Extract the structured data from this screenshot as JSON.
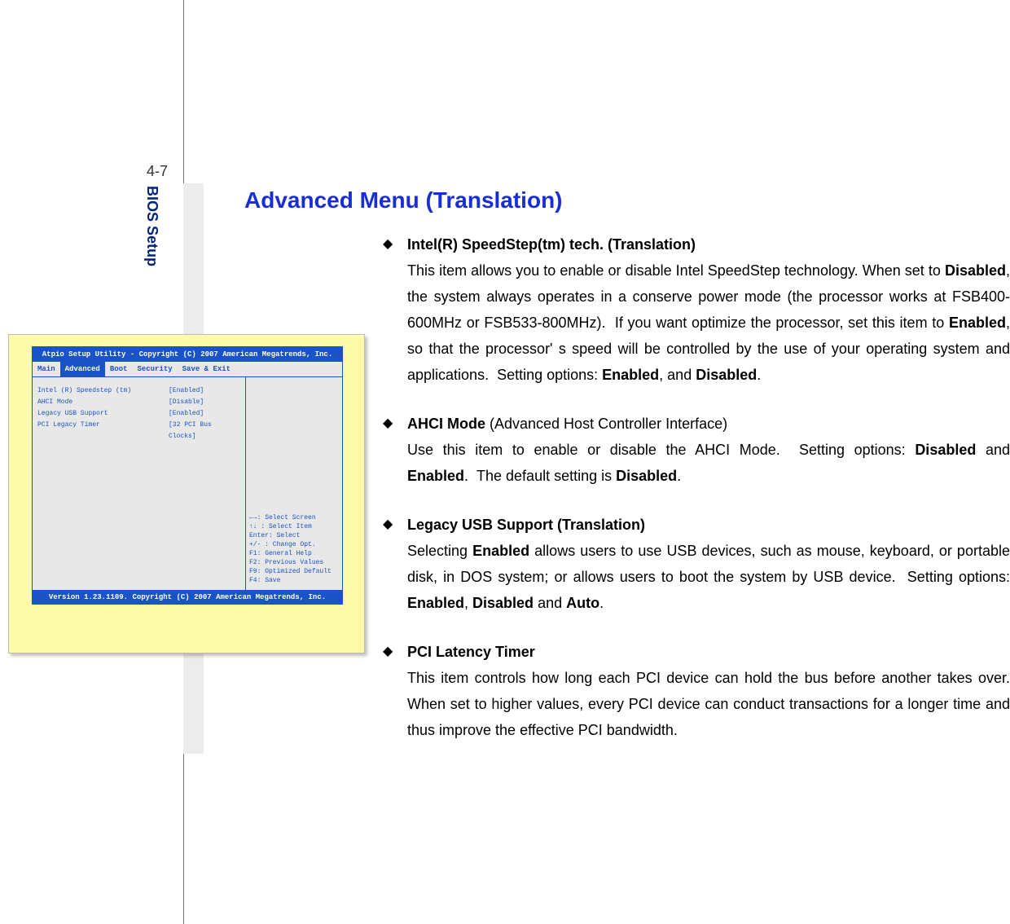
{
  "page": {
    "number": "4-7",
    "side_label": "BIOS Setup",
    "heading": "Advanced Menu (Translation)"
  },
  "sections": [
    {
      "title": "Intel(R) SpeedStep(tm) tech. (Translation)",
      "title_trailing": "",
      "body_html": "This item allows you to enable or disable Intel SpeedStep technology. When set to <b>Disabled</b>, the system always operates in a conserve power mode (the processor works at FSB400-600MHz or FSB533-800MHz).&nbsp;&nbsp;If you want optimize the processor, set this item to <b>Enabled</b>, so that the processor' s speed will be controlled by the use of your operating system and applications.&nbsp;&nbsp;Setting options: <b>Enabled</b>, and <b>Disabled</b>."
    },
    {
      "title": "AHCI Mode",
      "title_trailing": " (Advanced Host Controller Interface)",
      "body_html": "Use this item to enable or disable the AHCI Mode.&nbsp;&nbsp;Setting options: <b>Disabled</b> and <b>Enabled</b>.&nbsp;&nbsp;The default setting is <b>Disabled</b>."
    },
    {
      "title": "Legacy USB Support (Translation)",
      "title_trailing": "",
      "body_html": "Selecting <b>Enabled</b> allows users to use USB devices, such as mouse, keyboard, or portable disk, in DOS system; or allows users to boot the system by USB device.&nbsp;&nbsp;Setting options: <b>Enabled</b>, <b>Disabled</b> and <b>Auto</b>."
    },
    {
      "title": "PCI Latency Timer",
      "title_trailing": "",
      "body_html": "This item controls how long each PCI device can hold the bus before another takes over. When set to higher values, every PCI device can conduct transactions for a longer time and thus improve the effective PCI bandwidth."
    }
  ],
  "bios": {
    "header": "Atpio Setup Utility - Copyright (C) 2007 American Megatrends, Inc.",
    "footer": "Version 1.23.1109. Copyright (C) 2007 American Megatrends, Inc.",
    "tabs": [
      "Main",
      "Advanced",
      "Boot",
      "Security",
      "Save & Exit"
    ],
    "active_tab": 1,
    "rows": [
      {
        "k": "Intel (R) Speedstep (tm)",
        "v": "[Enabled]"
      },
      {
        "k": "AHCI Mode",
        "v": "[Disable]"
      },
      {
        "k": "Legacy USB Support",
        "v": "[Enabled]"
      },
      {
        "k": "PCI Legacy Timer",
        "v": "[32 PCI Bus Clocks]"
      }
    ],
    "help": [
      "←→: Select Screen",
      "↑↓ : Select Item",
      "Enter: Select",
      "+/- : Change Opt.",
      "F1: General Help",
      "F2: Previous Values",
      "F9: Optimized Default",
      "F4: Save"
    ]
  }
}
